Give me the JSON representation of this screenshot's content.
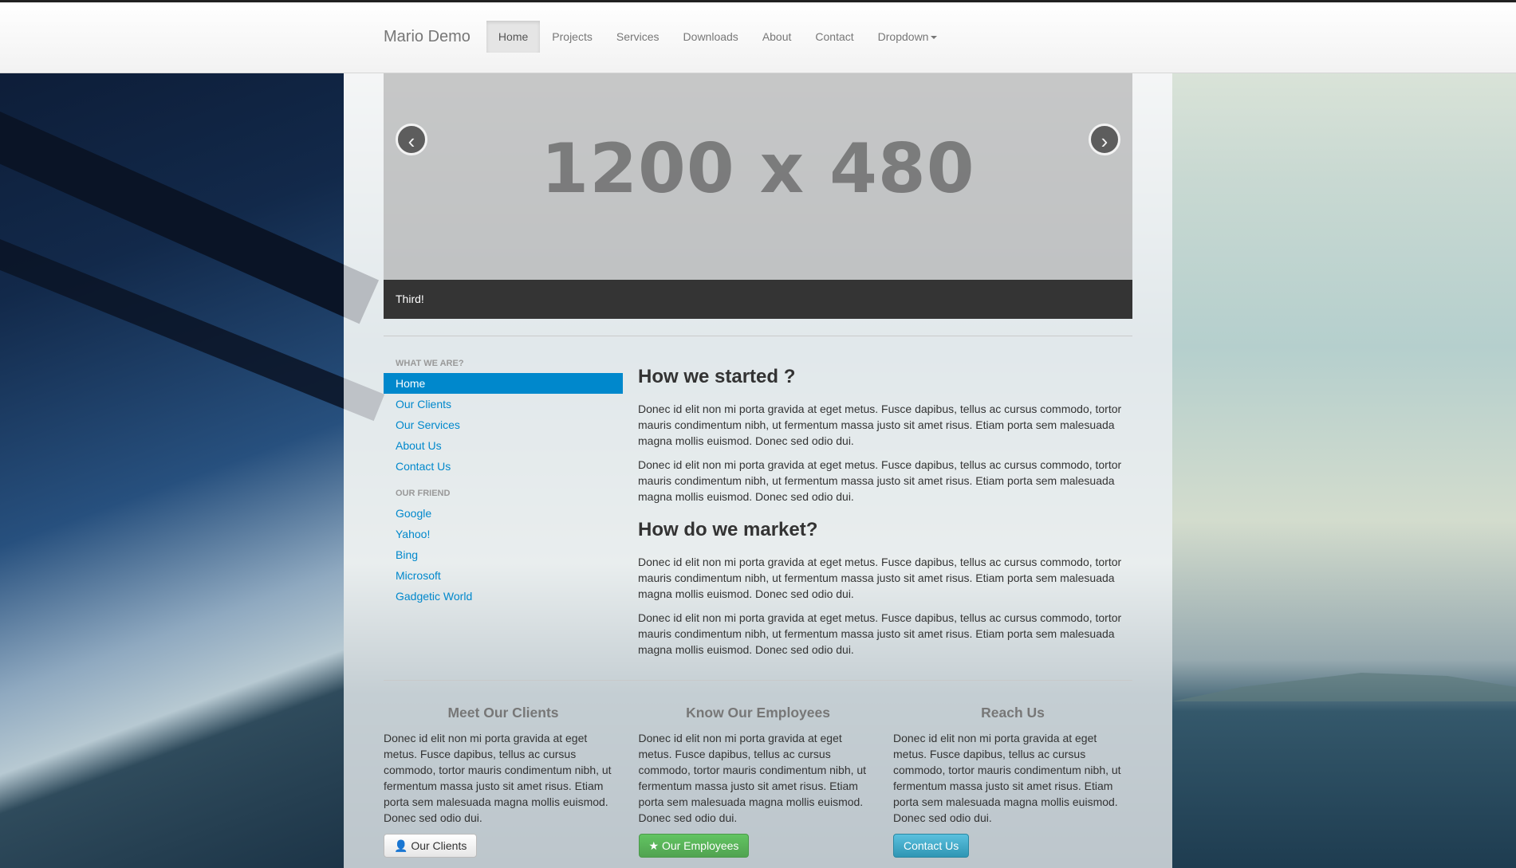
{
  "brand": "Mario Demo",
  "nav": {
    "items": [
      "Home",
      "Projects",
      "Services",
      "Downloads",
      "About",
      "Contact",
      "Dropdown"
    ],
    "active": "Home"
  },
  "carousel": {
    "placeholder": "1200 x 480",
    "caption": "Third!",
    "prev_icon": "‹",
    "next_icon": "›"
  },
  "sidebar": {
    "header1": "What we are?",
    "section1": [
      "Home",
      "Our Clients",
      "Our Services",
      "About Us",
      "Contact Us"
    ],
    "header2": "Our Friend",
    "section2": [
      "Google",
      "Yahoo!",
      "Bing",
      "Microsoft",
      "Gadgetic World"
    ],
    "active": "Home"
  },
  "content": {
    "heading1": "How we started ?",
    "heading2": "How do we market?",
    "paragraph": "Donec id elit non mi porta gravida at eget metus. Fusce dapibus, tellus ac cursus commodo, tortor mauris condimentum nibh, ut fermentum massa justo sit amet risus. Etiam porta sem malesuada magna mollis euismod. Donec sed odio dui."
  },
  "columns": [
    {
      "title": "Meet Our Clients",
      "text": "Donec id elit non mi porta gravida at eget metus. Fusce dapibus, tellus ac cursus commodo, tortor mauris condimentum nibh, ut fermentum massa justo sit amet risus. Etiam porta sem malesuada magna mollis euismod. Donec sed odio dui.",
      "button": "Our Clients",
      "icon": "user-icon"
    },
    {
      "title": "Know Our Employees",
      "text": "Donec id elit non mi porta gravida at eget metus. Fusce dapibus, tellus ac cursus commodo, tortor mauris condimentum nibh, ut fermentum massa justo sit amet risus. Etiam porta sem malesuada magna mollis euismod. Donec sed odio dui.",
      "button": "Our Employees",
      "icon": "star-icon"
    },
    {
      "title": "Reach Us",
      "text": "Donec id elit non mi porta gravida at eget metus. Fusce dapibus, tellus ac cursus commodo, tortor mauris condimentum nibh, ut fermentum massa justo sit amet risus. Etiam porta sem malesuada magna mollis euismod. Donec sed odio dui.",
      "button": "Contact Us"
    }
  ],
  "colors": {
    "link": "#0088cc",
    "active_nav_bg": "#e5e5e5",
    "success": "#51a351",
    "info": "#2f96b4"
  }
}
